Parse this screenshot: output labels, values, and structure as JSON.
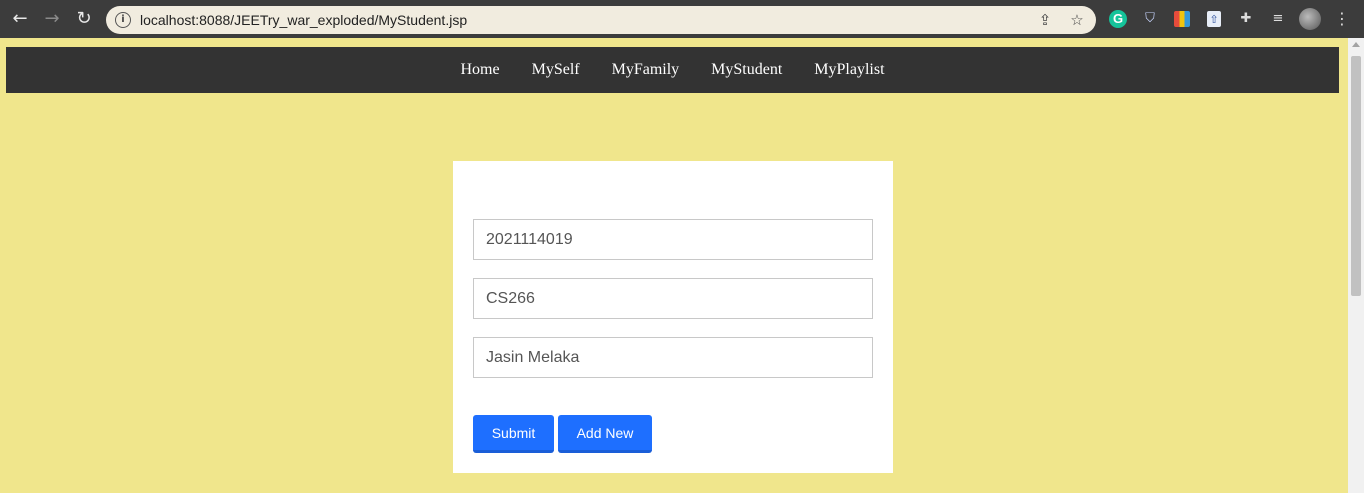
{
  "browser": {
    "url": "localhost:8088/JEETry_war_exploded/MyStudent.jsp",
    "icons": [
      "back-icon",
      "forward-icon",
      "reload-icon",
      "info-icon",
      "share-icon",
      "star-icon",
      "grammarly-icon",
      "shield-icon",
      "color-extension-icon",
      "document-extension-icon",
      "puzzle-icon",
      "media-icon",
      "avatar",
      "menu-icon"
    ]
  },
  "nav": {
    "items": [
      "Home",
      "MySelf",
      "MyFamily",
      "MyStudent",
      "MyPlaylist"
    ]
  },
  "form": {
    "student_id": "2021114019",
    "course": "CS266",
    "address": "Jasin Melaka",
    "submit_label": "Submit",
    "add_new_label": "Add New"
  },
  "colors": {
    "page_background": "#f0e68c",
    "nav_background": "#333333",
    "button": "#1e6fff"
  }
}
